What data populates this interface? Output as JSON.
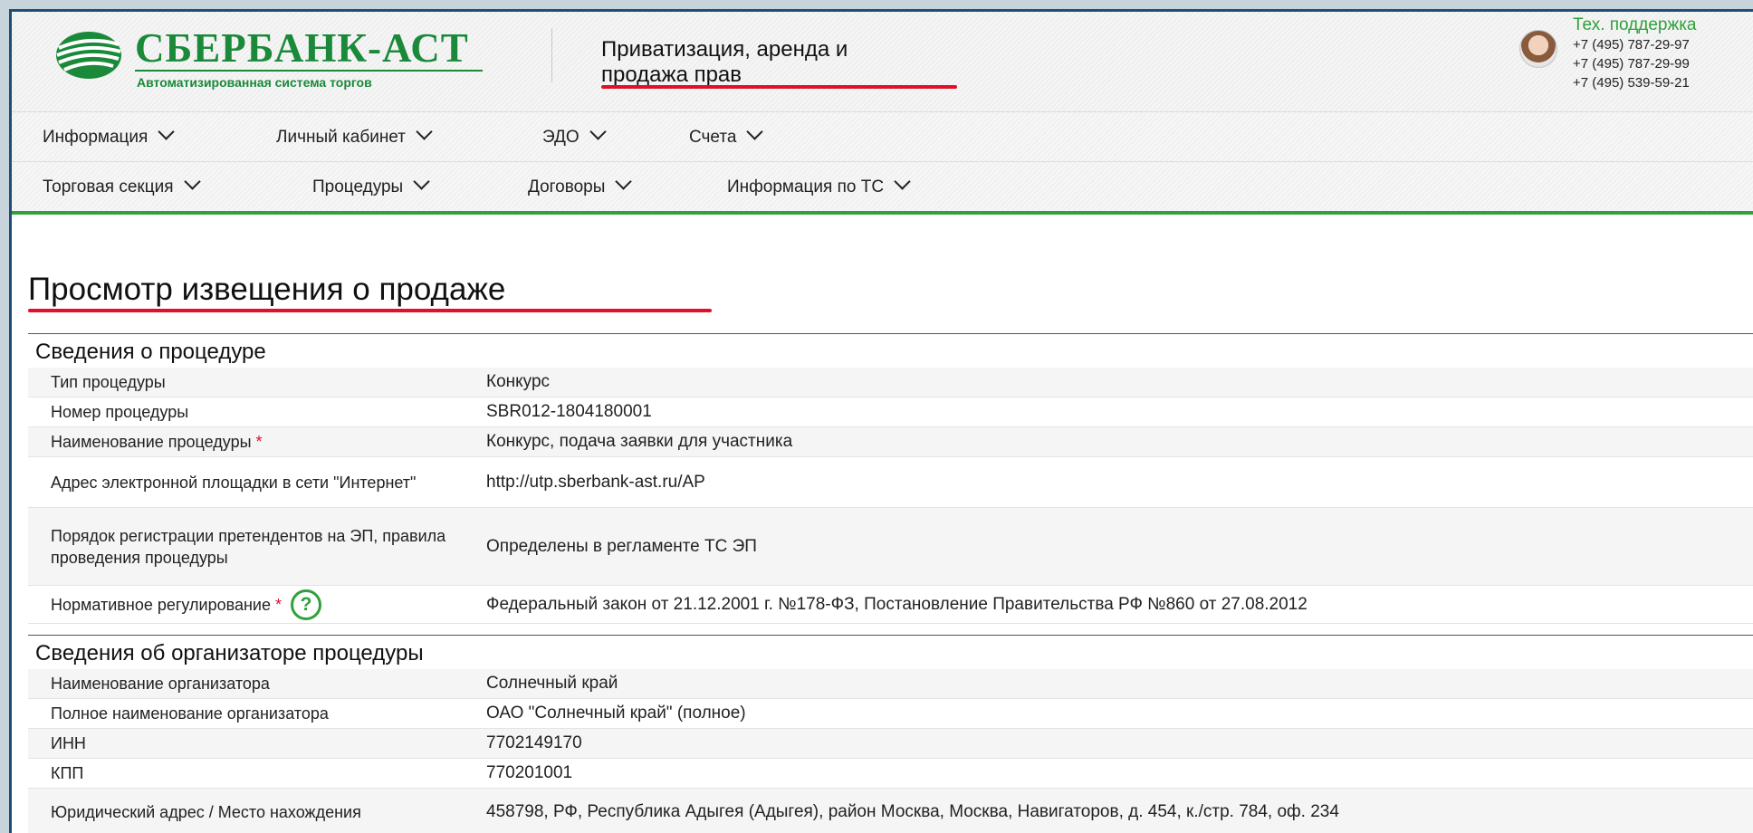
{
  "header": {
    "logo_title": "СБЕРБАНК-АСТ",
    "logo_subtitle": "Автоматизированная система торгов",
    "section_line1": "Приватизация, аренда и",
    "section_line2": "продажа прав",
    "support_title": "Тех. поддержка",
    "phones": [
      "+7 (495) 787-29-97",
      "+7 (495) 787-29-99",
      "+7 (495) 539-59-21"
    ]
  },
  "menu_top": [
    {
      "label": "Информация"
    },
    {
      "label": "Личный кабинет"
    },
    {
      "label": "ЭДО"
    },
    {
      "label": "Счета"
    }
  ],
  "menu_bottom": [
    {
      "label": "Торговая секция"
    },
    {
      "label": "Процедуры"
    },
    {
      "label": "Договоры"
    },
    {
      "label": "Информация по ТС"
    }
  ],
  "page_title": "Просмотр извещения о продаже",
  "procedure": {
    "heading": "Сведения о процедуре",
    "rows": [
      {
        "label": "Тип процедуры",
        "value": "Конкурс"
      },
      {
        "label": "Номер процедуры",
        "value": "SBR012-1804180001"
      },
      {
        "label": "Наименование процедуры",
        "value": "Конкурс, подача заявки для участника",
        "required": "*"
      },
      {
        "label": "Адрес электронной площадки в сети \"Интернет\"",
        "value": "http://utp.sberbank-ast.ru/AP"
      },
      {
        "label": "Порядок регистрации претендентов на ЭП, правила проведения процедуры",
        "value": "Определены в регламенте ТС ЭП"
      },
      {
        "label": "Нормативное регулирование",
        "value": "Федеральный закон от 21.12.2001 г. №178-ФЗ, Постановление Правительства РФ №860 от 27.08.2012",
        "required": "*",
        "help": "?"
      }
    ]
  },
  "organizer": {
    "heading": "Сведения об организаторе процедуры",
    "rows": [
      {
        "label": "Наименование организатора",
        "value": "Солнечный край"
      },
      {
        "label": "Полное наименование организатора",
        "value": "ОАО \"Солнечный край\" (полное)"
      },
      {
        "label": "ИНН",
        "value": "7702149170"
      },
      {
        "label": "КПП",
        "value": "770201001"
      },
      {
        "label": "Юридический адрес / Место нахождения",
        "value": "458798, РФ, Республика Адыгея (Адыгея), район Москва, Москва, Навигаторов, д. 454, к./стр. 784, оф. 234"
      }
    ]
  },
  "colors": {
    "brand_green": "#1a8a3a",
    "accent_red": "#e0102a",
    "menu_underline": "#2fa13b"
  }
}
